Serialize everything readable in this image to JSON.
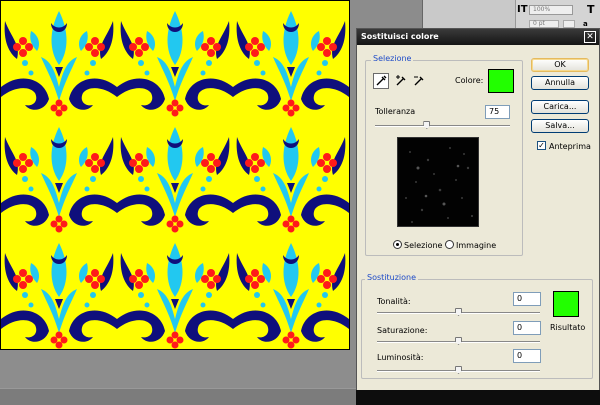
{
  "dialog": {
    "title": "Sostituisci colore",
    "close_glyph": "✕",
    "selection": {
      "group_label": "Selezione",
      "color_label": "Colore:",
      "color_value": "#22ff00",
      "tolerance_label": "Tolleranza",
      "tolerance_value": "75",
      "tolerance_fraction": 0.38,
      "radio_selection_label": "Selezione",
      "radio_image_label": "Immagine"
    },
    "replacement": {
      "group_label": "Sostituzione",
      "hue_label": "Tonalità:",
      "hue_value": "0",
      "saturation_label": "Saturazione:",
      "saturation_value": "0",
      "lightness_label": "Luminosità:",
      "lightness_value": "0",
      "result_label": "Risultato",
      "result_color": "#22ff00"
    },
    "buttons": {
      "ok": "OK",
      "cancel": "Annulla",
      "load": "Carica...",
      "save": "Salva..."
    },
    "preview_label": "Anteprima",
    "preview_checked": true
  },
  "right_panel": {
    "zoom": "100%",
    "field2": "0 pt"
  },
  "colors": {
    "pattern_bg": "#ffff00",
    "pattern_cyan": "#22c8f0",
    "pattern_navy": "#0f0f7c",
    "pattern_red": "#ff1a1a",
    "green": "#22ff00"
  }
}
